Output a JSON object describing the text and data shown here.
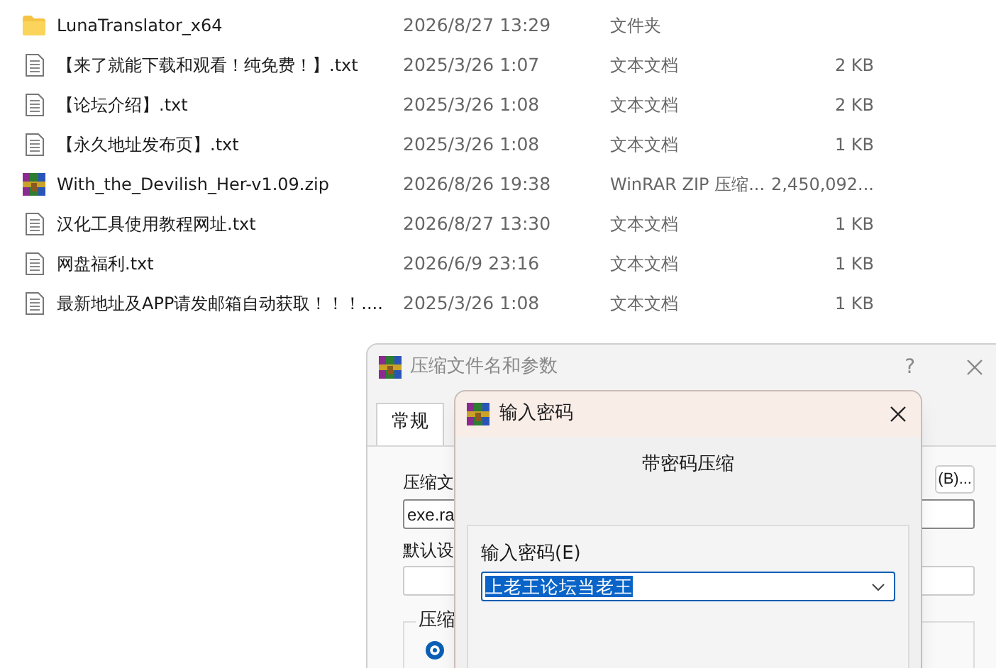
{
  "files": [
    {
      "kind": "folder",
      "name": "LunaTranslator_x64",
      "date": "2026/8/27 13:29",
      "type": "文件夹"
    },
    {
      "kind": "text",
      "name": "【来了就能下载和观看！纯免费！】.txt",
      "date": "2025/3/26 1:07",
      "type": "文本文档",
      "size": "2 KB"
    },
    {
      "kind": "text",
      "name": "【论坛介绍】.txt",
      "date": "2025/3/26 1:08",
      "type": "文本文档",
      "size": "2 KB"
    },
    {
      "kind": "text",
      "name": "【永久地址发布页】.txt",
      "date": "2025/3/26 1:08",
      "type": "文本文档",
      "size": "1 KB"
    },
    {
      "kind": "archive",
      "name": "With_the_Devilish_Her-v1.09.zip",
      "date": "2026/8/26 19:38",
      "type": "WinRAR ZIP 压缩...",
      "size": "2,450,092..."
    },
    {
      "kind": "text",
      "name": "汉化工具使用教程网址.txt",
      "date": "2026/8/27 13:30",
      "type": "文本文档",
      "size": "1 KB"
    },
    {
      "kind": "text",
      "name": "网盘福利.txt",
      "date": "2026/6/9 23:16",
      "type": "文本文档",
      "size": "1 KB"
    },
    {
      "kind": "text",
      "name": "最新地址及APP请发邮箱自动获取！！！....",
      "date": "2025/3/26 1:08",
      "type": "文本文档",
      "size": "1 KB"
    }
  ],
  "archive_dialog": {
    "title": "压缩文件名和参数",
    "help": "?",
    "tabs": [
      {
        "label": "常规",
        "selected": true
      }
    ],
    "filename_label": "压缩文",
    "browse_button": "(B)...",
    "filename_value": "exe.ra",
    "profile_label": "默认设",
    "group_label": "压缩",
    "format_radio": {
      "selected": true
    }
  },
  "password_dialog": {
    "title": "输入密码",
    "heading": "带密码压缩",
    "field_label": "输入密码(E)",
    "password_value": "上老王论坛当老王"
  }
}
